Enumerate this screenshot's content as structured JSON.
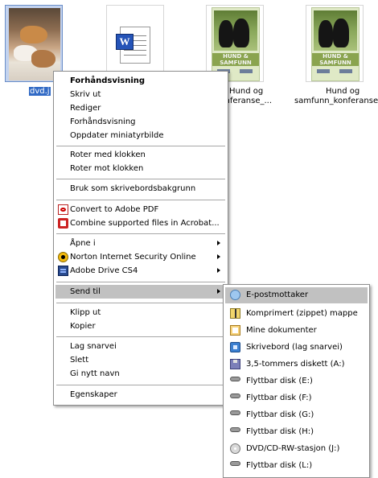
{
  "files": [
    {
      "label": "dvd.j",
      "selected": true,
      "icon": "dog-photo-thumbnail"
    },
    {
      "label": "",
      "selected": false,
      "icon": "word-document-icon"
    },
    {
      "label_line1": "Hund og",
      "label_line2": "_konferanse_...",
      "icon": "hund-og-samfunn-cover"
    },
    {
      "label_line1": "Hund og",
      "label_line2": "samfunn_konferanse_",
      "icon": "hund-og-samfunn-cover"
    }
  ],
  "cover": {
    "title_line1": "HUND &",
    "title_line2": "SAMFUNN"
  },
  "context_menu": {
    "group1": [
      "Forhåndsvisning",
      "Skriv ut",
      "Rediger",
      "Forhåndsvisning",
      "Oppdater miniatyrbilde"
    ],
    "group2": [
      "Roter med klokken",
      "Roter mot klokken"
    ],
    "group3": [
      "Bruk som skrivebordsbakgrunn"
    ],
    "group4": [
      {
        "label": "Convert to Adobe PDF",
        "icon": "pdf-icon"
      },
      {
        "label": "Combine supported files in Acrobat...",
        "icon": "acrobat-icon"
      }
    ],
    "group5": [
      {
        "label": "Åpne i",
        "submenu": true
      },
      {
        "label": "Norton Internet Security Online",
        "icon": "norton-icon",
        "submenu": true
      },
      {
        "label": "Adobe Drive CS4",
        "icon": "adobe-drive-icon",
        "submenu": true
      }
    ],
    "group6": [
      {
        "label": "Send til",
        "submenu": true,
        "highlighted": true
      }
    ],
    "group7": [
      "Klipp ut",
      "Kopier"
    ],
    "group8": [
      "Lag snarvei",
      "Slett",
      "Gi nytt navn"
    ],
    "group9": [
      "Egenskaper"
    ]
  },
  "send_to_menu": [
    {
      "label": "E-postmottaker",
      "icon": "mail-recipient-icon",
      "highlighted": true
    },
    {
      "label": "Komprimert (zippet) mappe",
      "icon": "zip-folder-icon"
    },
    {
      "label": "Mine dokumenter",
      "icon": "my-documents-icon"
    },
    {
      "label": "Skrivebord (lag snarvei)",
      "icon": "desktop-icon"
    },
    {
      "label": "3,5-tommers diskett (A:)",
      "icon": "floppy-icon"
    },
    {
      "label": "Flyttbar disk (E:)",
      "icon": "removable-disk-icon"
    },
    {
      "label": "Flyttbar disk (F:)",
      "icon": "removable-disk-icon"
    },
    {
      "label": "Flyttbar disk (G:)",
      "icon": "removable-disk-icon"
    },
    {
      "label": "Flyttbar disk (H:)",
      "icon": "removable-disk-icon"
    },
    {
      "label": "DVD/CD-RW-stasjon (J:)",
      "icon": "dvd-drive-icon"
    },
    {
      "label": "Flyttbar disk (L:)",
      "icon": "removable-disk-icon"
    }
  ],
  "colors": {
    "highlight": "#c1c1c1",
    "selection": "#316ac5"
  }
}
